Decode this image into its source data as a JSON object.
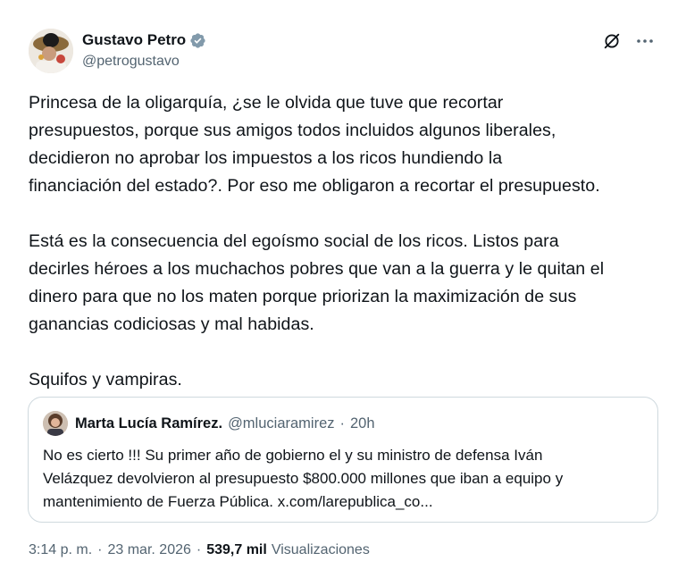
{
  "author": {
    "name": "Gustavo Petro",
    "handle": "@petrogustavo",
    "verified": true,
    "verified_color": "#829aab"
  },
  "tweet": {
    "paragraphs": [
      "Princesa de la oligarquía, ¿se le olvida que tuve que recortar\npresupuestos, porque sus amigos todos incluidos algunos liberales,\ndecidieron no aprobar los impuestos a los ricos hundiendo la\nfinanciación del estado?. Por eso me obligaron a recortar el presupuesto.",
      "Está es la consecuencia del egoísmo social de los ricos. Listos para\ndecirles héroes a los muchachos pobres que van a la guerra y le quitan el\ndinero para que no los maten porque priorizan la maximización de sus\nganancias codiciosas y mal habidas.",
      "Squifos y vampiras."
    ]
  },
  "quote": {
    "name": "Marta Lucía Ramírez.",
    "handle": "@mluciaramirez",
    "separator": "·",
    "time": "20h",
    "text": "No es cierto !!! Su primer año de gobierno el y su ministro de defensa Iván\nVelázquez devolvieron al presupuesto $800.000 millones que iban a equipo y\nmantenimiento de Fuerza Pública. x.com/larepublica_co..."
  },
  "meta": {
    "time": "3:14 p. m.",
    "date": "23 mar. 2026",
    "separator": "·",
    "views_count": "539,7 mil",
    "views_label": "Visualizaciones"
  },
  "icons": {
    "verified": "verified-badge-icon",
    "grok": "grok-icon",
    "more": "more-options-icon"
  }
}
